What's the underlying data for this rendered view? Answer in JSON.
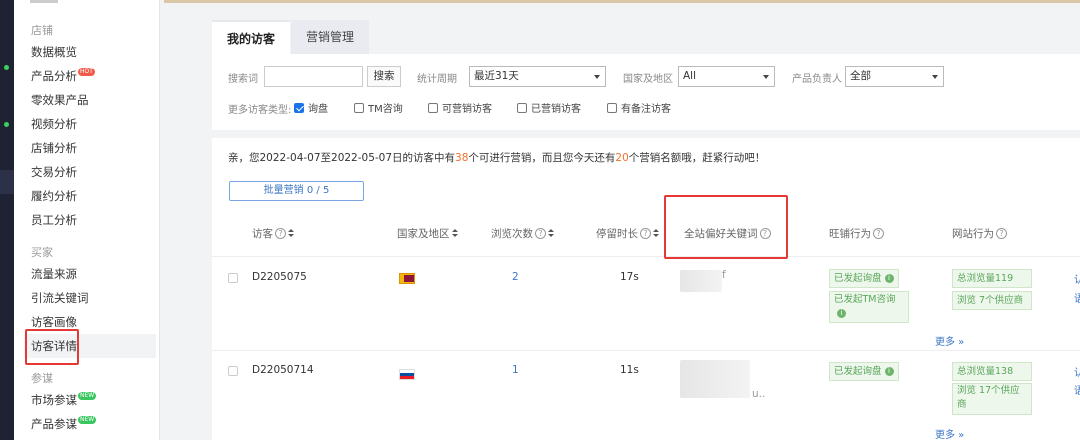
{
  "sidebar": {
    "section_store": "店铺",
    "store_items": [
      "数据概览",
      "产品分析",
      "零效果产品",
      "视频分析",
      "店铺分析",
      "交易分析",
      "履约分析",
      "员工分析"
    ],
    "section_buyer": "买家",
    "buyer_items": [
      "流量来源",
      "引流关键词",
      "访客画像",
      "访客详情"
    ],
    "section_advisor": "参谋",
    "advisor_items": [
      "市场参谋",
      "产品参谋"
    ],
    "badge_hot": "HOT",
    "badge_new": "NEW"
  },
  "tabs": [
    "我的访客",
    "营销管理"
  ],
  "filter": {
    "search_label": "搜索词",
    "search_value": "",
    "search_button": "搜索",
    "period_label": "统计周期",
    "period_value": "最近31天",
    "region_label": "国家及地区",
    "region_value": "All",
    "owner_label": "产品负责人",
    "owner_value": "全部",
    "types_label": "更多访客类型:",
    "types": [
      "询盘",
      "TM咨询",
      "可营销访客",
      "已营销访客",
      "有备注访客"
    ]
  },
  "notice": {
    "part1": "亲，您2022-04-07至2022-05-07日的访客中有",
    "count": "38",
    "part2": "个可进行营销，而且您今天还有",
    "quota": "20",
    "part3": "个营销名额哦，赶紧行动吧！"
  },
  "bulk_button": "批量营销  0 / 5",
  "table": {
    "headers": [
      "访客",
      "国家及地区",
      "浏览次数",
      "停留时长",
      "全站偏好关键词",
      "旺铺行为",
      "网站行为"
    ],
    "rows": [
      {
        "id": "D2205075",
        "views": "2",
        "duration": "17s",
        "keyword_tail": "f",
        "shop_tags": [
          "已发起询盘",
          "已发起TM咨询"
        ],
        "site_tags": [
          "总浏览量119",
          "浏览 7个供应商"
        ]
      },
      {
        "id": "D22050714",
        "views": "1",
        "duration": "11s",
        "keyword_tail": "u..",
        "shop_tags": [
          "已发起询盘"
        ],
        "site_tags": [
          "总浏览量138",
          "浏览 17个供应商"
        ]
      }
    ],
    "more": "更多 »"
  }
}
